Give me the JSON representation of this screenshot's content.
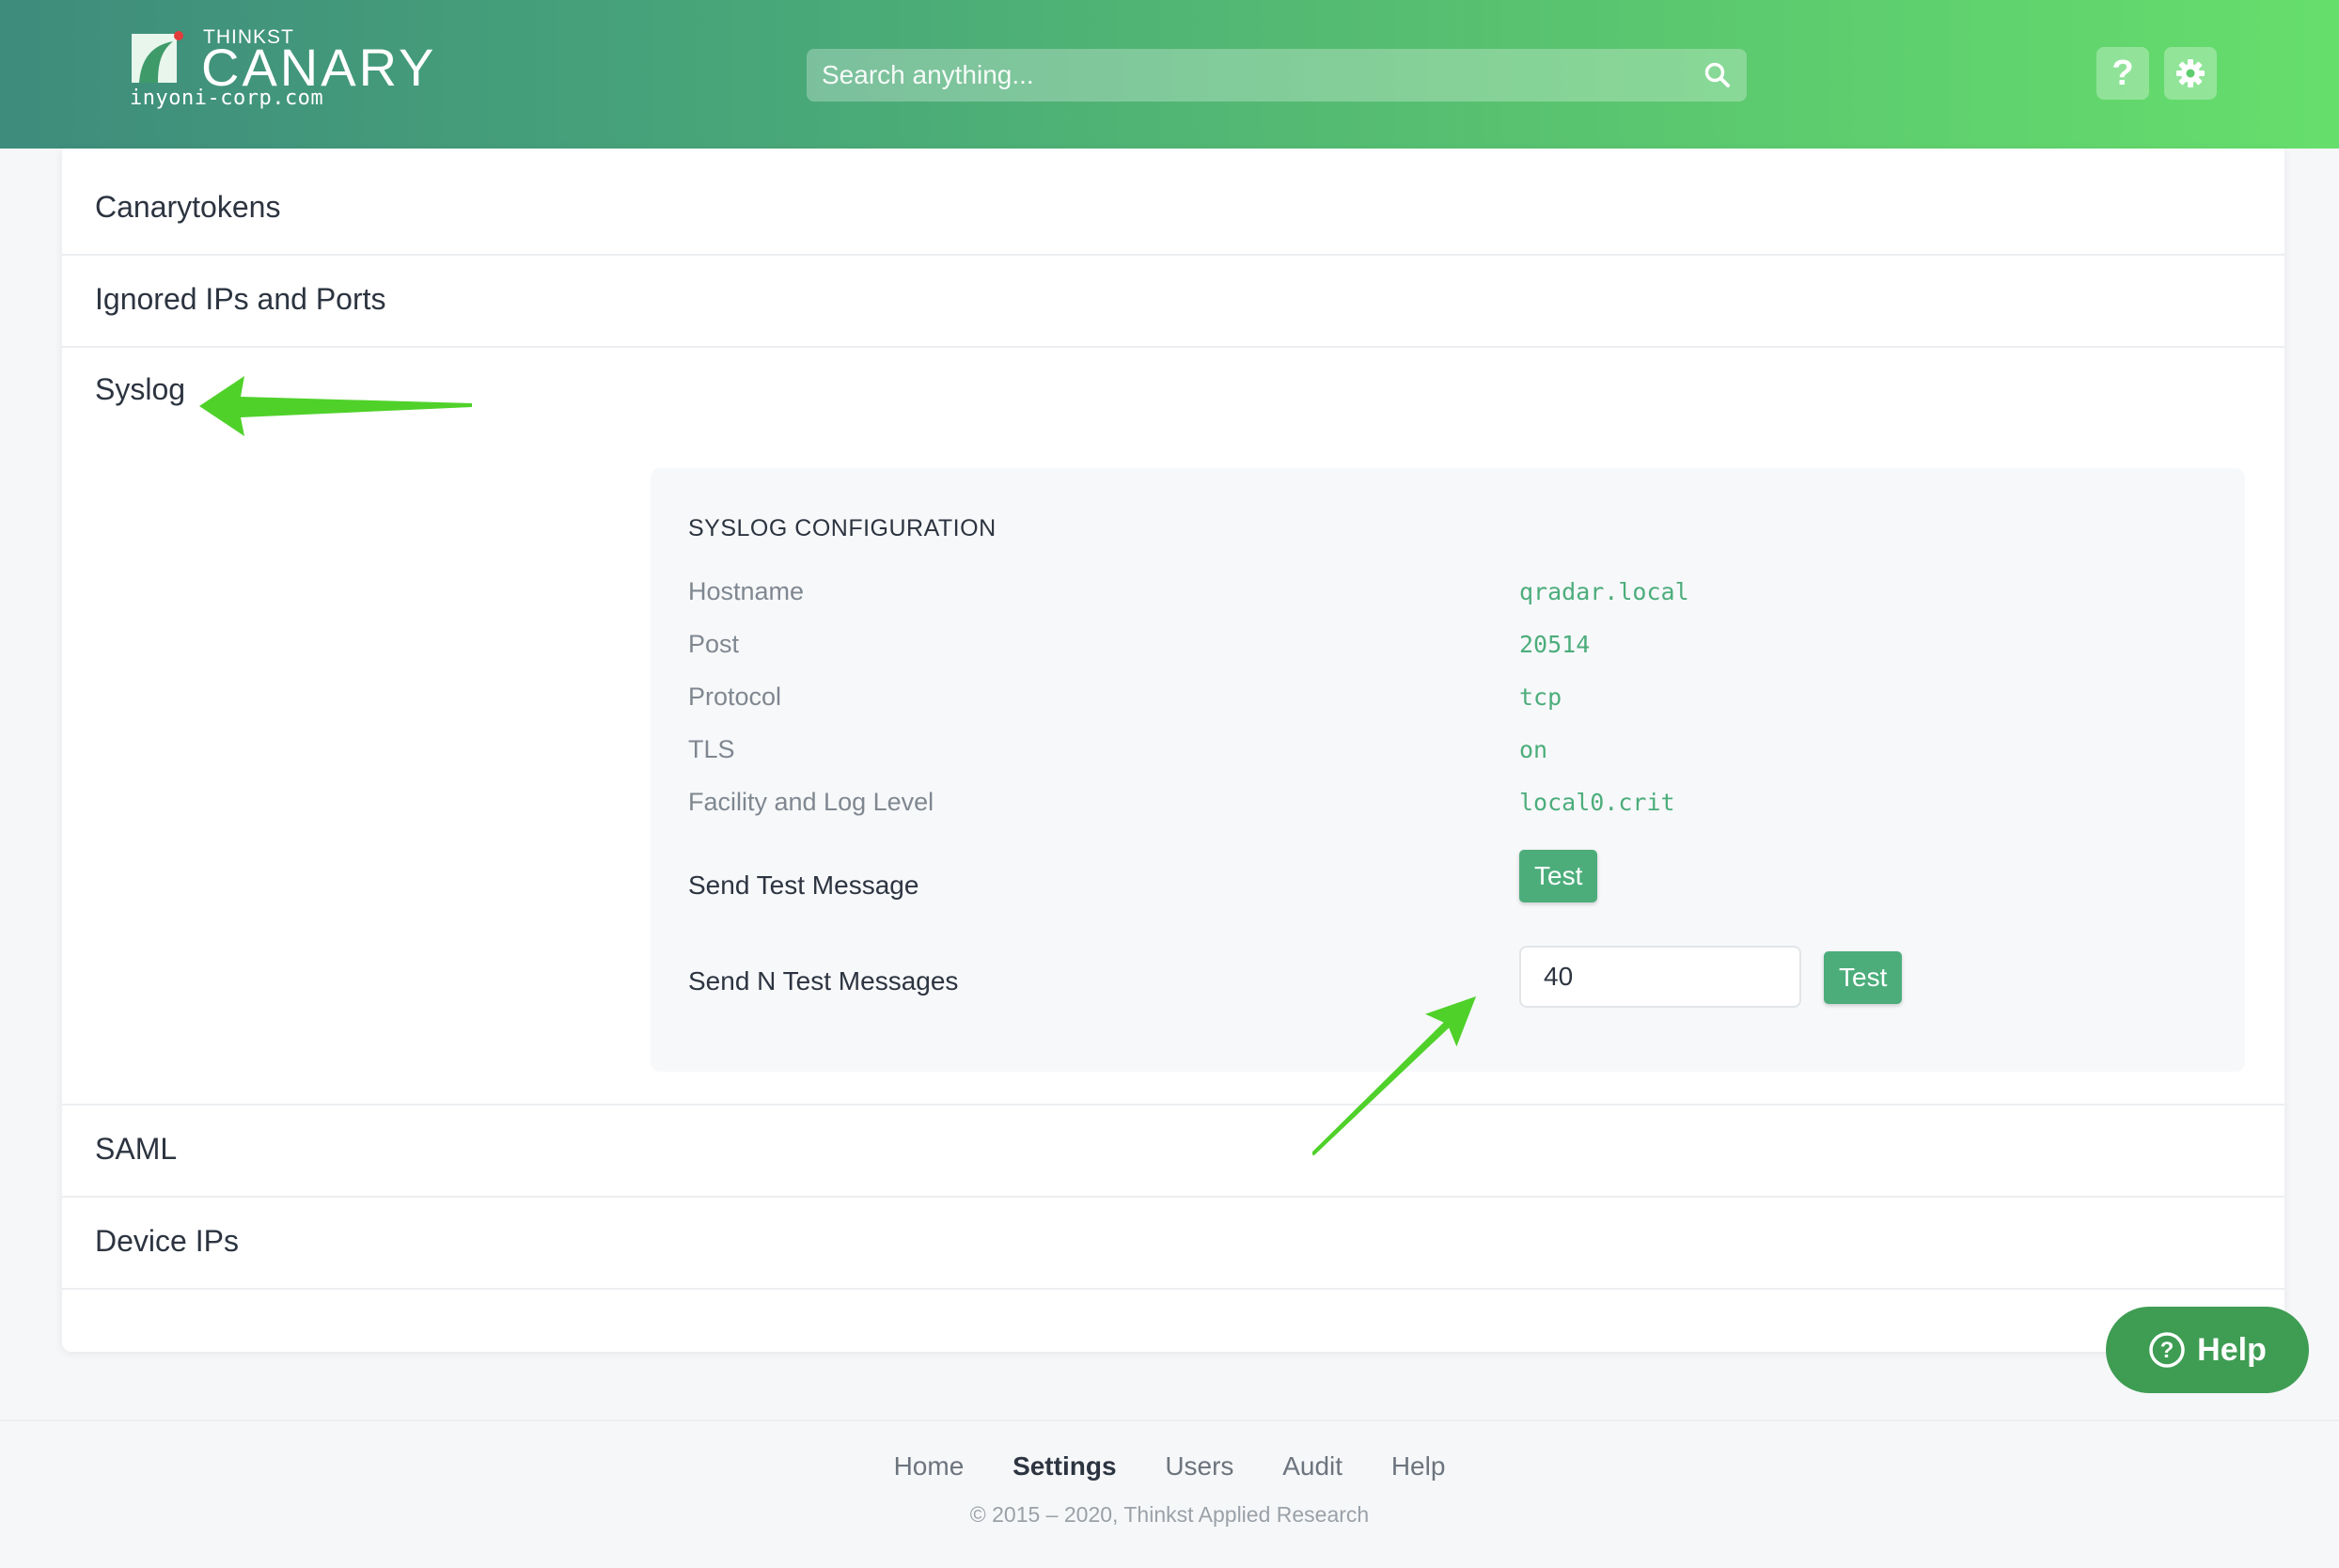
{
  "header": {
    "brand_small": "THINKST",
    "brand_large": "CANARY",
    "domain": "inyoni-corp.com",
    "search_placeholder": "Search anything...",
    "help_icon": "question-mark-icon",
    "settings_icon": "gear-icon"
  },
  "sections": [
    {
      "title": "Canarytokens"
    },
    {
      "title": "Ignored IPs and Ports"
    },
    {
      "title": "Syslog"
    },
    {
      "title": "SAML"
    },
    {
      "title": "Device IPs"
    }
  ],
  "syslog": {
    "panel_title": "SYSLOG CONFIGURATION",
    "fields": [
      {
        "label": "Hostname",
        "value": "qradar.local"
      },
      {
        "label": "Post",
        "value": "20514"
      },
      {
        "label": "Protocol",
        "value": "tcp"
      },
      {
        "label": "TLS",
        "value": "on"
      },
      {
        "label": "Facility and Log Level",
        "value": "local0.crit"
      }
    ],
    "send_test_label": "Send Test Message",
    "send_test_button": "Test",
    "send_n_label": "Send N Test Messages",
    "send_n_value": "40",
    "send_n_button": "Test"
  },
  "help_fab": {
    "label": "Help",
    "icon": "question-circle-icon"
  },
  "footer": {
    "nav": [
      {
        "label": "Home",
        "active": false
      },
      {
        "label": "Settings",
        "active": true
      },
      {
        "label": "Users",
        "active": false
      },
      {
        "label": "Audit",
        "active": false
      },
      {
        "label": "Help",
        "active": false
      }
    ],
    "copyright": "© 2015 – 2020, Thinkst Applied Research"
  },
  "colors": {
    "header_gradient_start": "#3e8c7c",
    "header_gradient_end": "#66de6c",
    "accent_green": "#4cad7b",
    "annotation_arrow": "#4fd12a",
    "help_fab": "#3e9d53"
  }
}
